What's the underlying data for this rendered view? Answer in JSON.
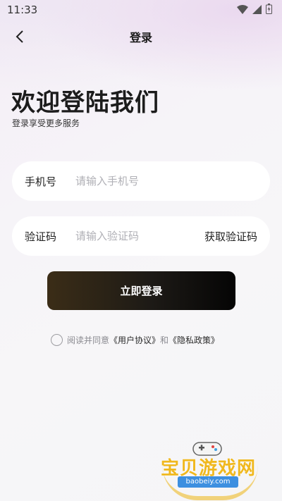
{
  "status_bar": {
    "time": "11:33"
  },
  "nav": {
    "title": "登录"
  },
  "welcome": {
    "headline": "欢迎登陆我们",
    "subline": "登录享受更多服务"
  },
  "phone_field": {
    "label": "手机号",
    "placeholder": "请输入手机号",
    "value": ""
  },
  "code_field": {
    "label": "验证码",
    "placeholder": "请输入验证码",
    "value": "",
    "get_code_label": "获取验证码"
  },
  "login_button": {
    "label": "立即登录"
  },
  "agreement": {
    "prefix": "阅读并同意",
    "user_agreement": "《用户协议》",
    "and": "和",
    "privacy_policy": "《隐私政策》",
    "checked": false
  },
  "watermark": {
    "text": "宝贝游戏网",
    "url": "baobeiy.com"
  },
  "colors": {
    "gold_accent": "#f0b81e",
    "button_dark": "#050505",
    "button_brown": "#3b2d17"
  }
}
